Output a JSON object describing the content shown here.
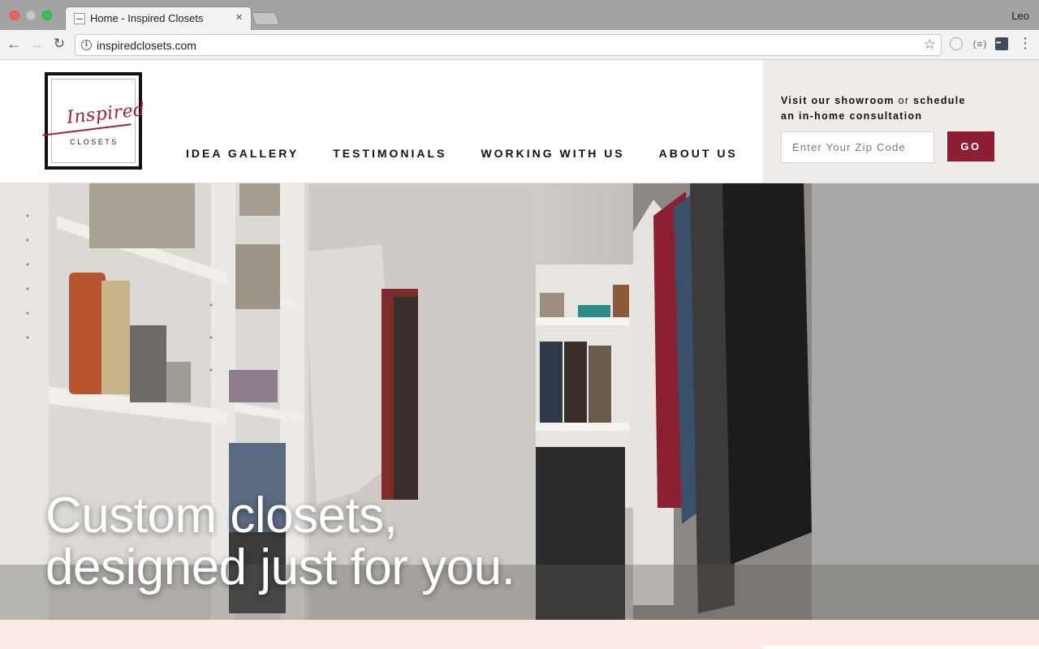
{
  "browser": {
    "tab_title": "Home - Inspired Closets",
    "tab_close": "×",
    "profile_name": "Leo",
    "url": "inspiredclosets.com",
    "icons": {
      "back": "←",
      "forward": "→",
      "reload": "↻",
      "info": "i",
      "star": "☆",
      "menu": "⋮",
      "ext_json": "{≡}"
    }
  },
  "logo": {
    "script_text": "Inspired",
    "sub_text": "CLOSETS"
  },
  "nav": {
    "items": [
      "IDEA GALLERY",
      "TESTIMONIALS",
      "WORKING WITH US",
      "ABOUT US"
    ]
  },
  "consult": {
    "line_part1": "Visit our showroom",
    "line_or": "or",
    "line_part2": "schedule",
    "line_part3": "an in-home consultation",
    "zip_placeholder": "Enter Your Zip Code",
    "go_label": "GO"
  },
  "hero": {
    "headline_line1": "Custom closets,",
    "headline_line2": "designed just for you."
  },
  "colors": {
    "brand": "#8c1e31",
    "consult_bg": "#efebe7",
    "footer_band": "#fce8e5"
  }
}
